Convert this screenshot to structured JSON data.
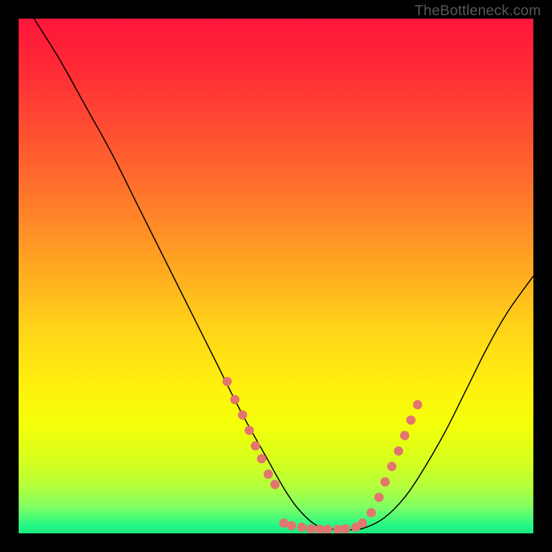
{
  "watermark": {
    "text": "TheBottleneck.com"
  },
  "gradient": {
    "stops": [
      {
        "offset": 0.0,
        "color": "#ff153a"
      },
      {
        "offset": 0.1,
        "color": "#ff2b36"
      },
      {
        "offset": 0.2,
        "color": "#ff4932"
      },
      {
        "offset": 0.3,
        "color": "#ff682d"
      },
      {
        "offset": 0.4,
        "color": "#ff8a27"
      },
      {
        "offset": 0.5,
        "color": "#ffae20"
      },
      {
        "offset": 0.6,
        "color": "#ffd318"
      },
      {
        "offset": 0.71,
        "color": "#fff00e"
      },
      {
        "offset": 0.79,
        "color": "#f3ff08"
      },
      {
        "offset": 0.86,
        "color": "#d6ff1e"
      },
      {
        "offset": 0.91,
        "color": "#b3ff3d"
      },
      {
        "offset": 0.95,
        "color": "#7dff64"
      },
      {
        "offset": 0.985,
        "color": "#22f885"
      },
      {
        "offset": 1.0,
        "color": "#1ee87f"
      }
    ]
  },
  "chart_data": {
    "type": "line",
    "title": "",
    "xlabel": "",
    "ylabel": "",
    "xlim": [
      0,
      100
    ],
    "ylim": [
      0,
      100
    ],
    "grid": false,
    "series": [
      {
        "name": "bottleneck-curve",
        "x": [
          0,
          3,
          8,
          13,
          18,
          23,
          28,
          33,
          38,
          43,
          48,
          52,
          55,
          58,
          61,
          64,
          67,
          71,
          75,
          79,
          83,
          87,
          91,
          95,
          100
        ],
        "y": [
          105,
          100,
          92,
          83,
          74,
          64,
          54,
          44,
          34,
          24,
          15,
          8,
          4,
          1.5,
          0.8,
          0.7,
          1,
          3,
          7,
          13,
          20,
          28,
          36,
          43,
          50
        ],
        "color": "#000000"
      }
    ],
    "markers": {
      "name": "highlight-dots",
      "color": "#e2756e",
      "radius_pct": 0.9,
      "points_xy": [
        [
          40.5,
          29.5
        ],
        [
          42.0,
          26.0
        ],
        [
          43.5,
          23.0
        ],
        [
          44.8,
          20.0
        ],
        [
          46.0,
          17.0
        ],
        [
          47.2,
          14.5
        ],
        [
          48.5,
          11.5
        ],
        [
          49.8,
          9.5
        ],
        [
          51.5,
          2.0
        ],
        [
          53.0,
          1.5
        ],
        [
          55.0,
          1.2
        ],
        [
          56.8,
          0.9
        ],
        [
          58.5,
          0.8
        ],
        [
          60.0,
          0.8
        ],
        [
          62.0,
          0.8
        ],
        [
          63.5,
          0.9
        ],
        [
          65.5,
          1.2
        ],
        [
          66.8,
          2.0
        ],
        [
          68.5,
          4.0
        ],
        [
          70.0,
          7.0
        ],
        [
          71.2,
          10.0
        ],
        [
          72.5,
          13.0
        ],
        [
          73.8,
          16.0
        ],
        [
          75.0,
          19.0
        ],
        [
          76.2,
          22.0
        ],
        [
          77.5,
          25.0
        ]
      ]
    }
  }
}
